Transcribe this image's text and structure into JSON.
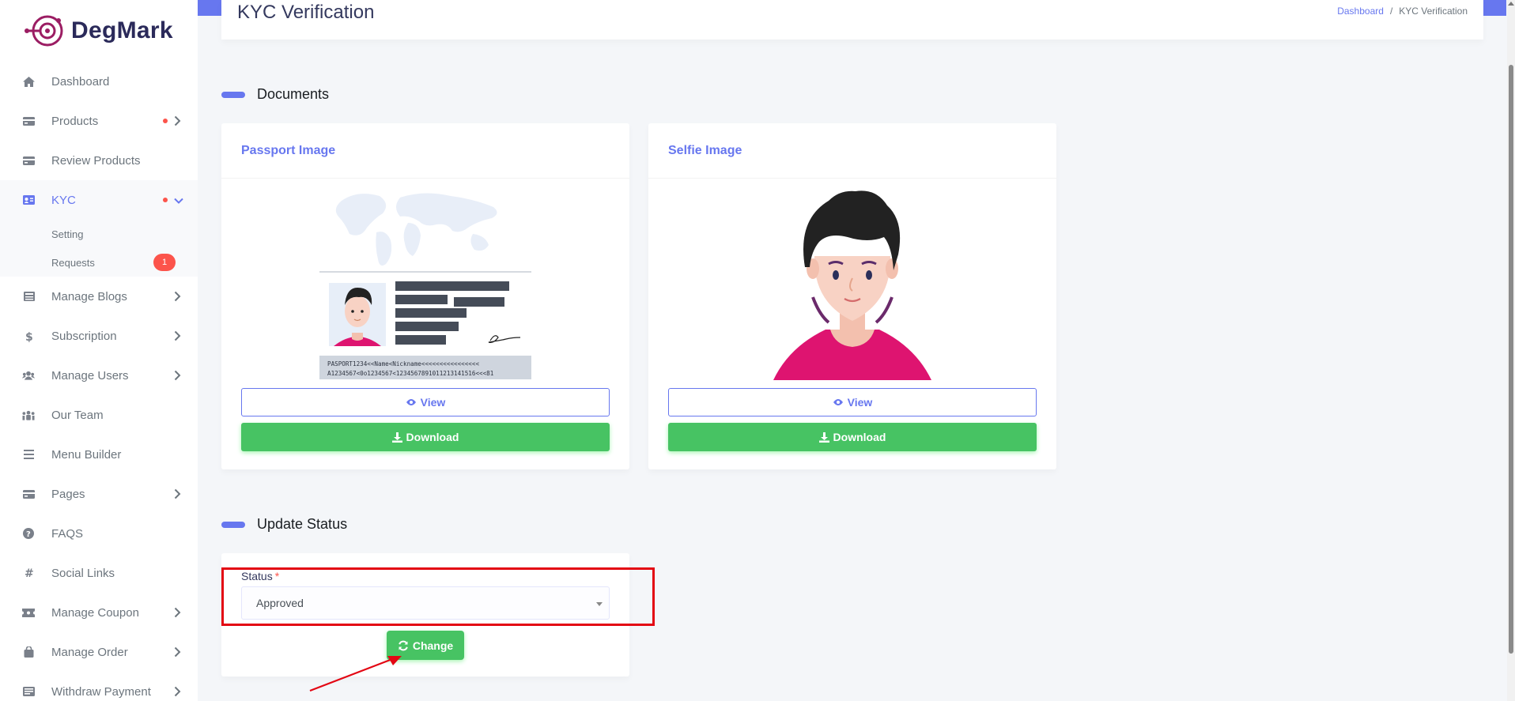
{
  "brand": {
    "name": "DegMark"
  },
  "sidebar": {
    "items": [
      {
        "label": "Dashboard",
        "icon": "home-icon",
        "chevron": false,
        "dot": false
      },
      {
        "label": "Products",
        "icon": "card-icon",
        "chevron": true,
        "dot": true
      },
      {
        "label": "Review Products",
        "icon": "card-icon",
        "chevron": false,
        "dot": false
      },
      {
        "label": "KYC",
        "icon": "id-card-icon",
        "chevron": true,
        "dot": true,
        "active": true,
        "subitems": [
          {
            "label": "Setting"
          },
          {
            "label": "Requests",
            "badge": "1"
          }
        ]
      },
      {
        "label": "Manage Blogs",
        "icon": "newspaper-icon",
        "chevron": true,
        "dot": false
      },
      {
        "label": "Subscription",
        "icon": "dollar-icon",
        "chevron": true,
        "dot": false
      },
      {
        "label": "Manage Users",
        "icon": "users-icon",
        "chevron": true,
        "dot": false
      },
      {
        "label": "Our Team",
        "icon": "team-icon",
        "chevron": false,
        "dot": false
      },
      {
        "label": "Menu Builder",
        "icon": "bars-icon",
        "chevron": false,
        "dot": false
      },
      {
        "label": "Pages",
        "icon": "card-icon",
        "chevron": true,
        "dot": false
      },
      {
        "label": "FAQS",
        "icon": "question-icon",
        "chevron": false,
        "dot": false
      },
      {
        "label": "Social Links",
        "icon": "hashtag-icon",
        "chevron": false,
        "dot": false
      },
      {
        "label": "Manage Coupon",
        "icon": "ticket-icon",
        "chevron": true,
        "dot": false
      },
      {
        "label": "Manage Order",
        "icon": "bag-icon",
        "chevron": true,
        "dot": false
      },
      {
        "label": "Withdraw Payment",
        "icon": "wallet-icon",
        "chevron": true,
        "dot": false
      }
    ]
  },
  "header": {
    "title": "KYC Verification",
    "breadcrumb": {
      "link": "Dashboard",
      "separator": "/",
      "current": "KYC Verification"
    }
  },
  "documents": {
    "section_title": "Documents",
    "passport": {
      "title": "Passport Image",
      "mrz_line1": "PASPORT1234<<Name<Nickname<<<<<<<<<<<<<<<<",
      "mrz_line2": "A1234567<0o1234567<1234567891011213141516<<<81",
      "view_label": "View",
      "download_label": "Download"
    },
    "selfie": {
      "title": "Selfie Image",
      "view_label": "View",
      "download_label": "Download"
    }
  },
  "update_status": {
    "section_title": "Update Status",
    "status_label": "Status",
    "required_mark": "*",
    "status_value": "Approved",
    "change_label": "Change"
  },
  "colors": {
    "primary": "#6777ef",
    "success": "#47c363",
    "danger": "#fc544b",
    "annotation": "#e30613"
  }
}
